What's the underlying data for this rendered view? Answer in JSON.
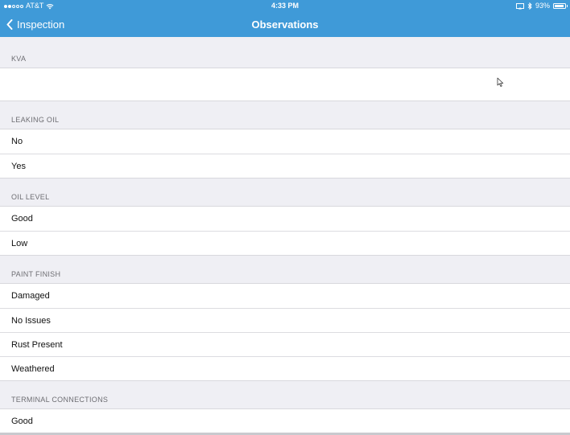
{
  "status_bar": {
    "carrier": "AT&T",
    "time": "4:33 PM",
    "battery_percent": "93%",
    "battery_level": 0.93,
    "signal_bars_filled": 2,
    "signal_bars_total": 5
  },
  "nav": {
    "back_label": "Inspection",
    "title": "Observations"
  },
  "sections": [
    {
      "header": "KVA",
      "items": [
        ""
      ]
    },
    {
      "header": "LEAKING OIL",
      "items": [
        "No",
        "Yes"
      ]
    },
    {
      "header": "OIL LEVEL",
      "items": [
        "Good",
        "Low"
      ]
    },
    {
      "header": "PAINT FINISH",
      "items": [
        "Damaged",
        "No Issues",
        "Rust Present",
        "Weathered"
      ]
    },
    {
      "header": "TERMINAL CONNECTIONS",
      "items": [
        "Good"
      ]
    }
  ],
  "colors": {
    "nav_background": "#3f9ad8",
    "page_background": "#efeff4"
  }
}
